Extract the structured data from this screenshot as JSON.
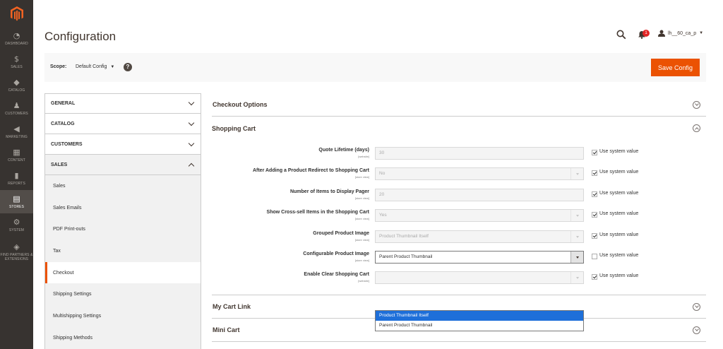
{
  "sidebar": {
    "logo": "magento-logo",
    "items": [
      {
        "label": "DASHBOARD",
        "icon": "◔",
        "name": "dashboard"
      },
      {
        "label": "SALES",
        "icon": "$",
        "name": "sales"
      },
      {
        "label": "CATALOG",
        "icon": "◆",
        "name": "catalog"
      },
      {
        "label": "CUSTOMERS",
        "icon": "♟",
        "name": "customers"
      },
      {
        "label": "MARKETING",
        "icon": "◀",
        "name": "marketing"
      },
      {
        "label": "CONTENT",
        "icon": "▦",
        "name": "content"
      },
      {
        "label": "REPORTS",
        "icon": "▮",
        "name": "reports"
      },
      {
        "label": "STORES",
        "icon": "▤",
        "name": "stores"
      },
      {
        "label": "SYSTEM",
        "icon": "⚙",
        "name": "system"
      },
      {
        "label": "FIND PARTNERS & EXTENSIONS",
        "icon": "◈",
        "name": "find-partners"
      }
    ]
  },
  "header": {
    "title": "Configuration",
    "notifications_count": "1",
    "user_name": "lh__60_ca_p"
  },
  "scope": {
    "label": "Scope:",
    "value": "Default Config",
    "help": "?"
  },
  "actions": {
    "save_label": "Save Config"
  },
  "tabs": [
    {
      "label": "GENERAL",
      "open": false
    },
    {
      "label": "CATALOG",
      "open": false
    },
    {
      "label": "CUSTOMERS",
      "open": false
    },
    {
      "label": "SALES",
      "open": true
    }
  ],
  "sales_items": [
    "Sales",
    "Sales Emails",
    "PDF Print-outs",
    "Tax",
    "Checkout",
    "Shipping Settings",
    "Multishipping Settings",
    "Shipping Methods"
  ],
  "sections": {
    "checkout_options": "Checkout Options",
    "shopping_cart": "Shopping Cart",
    "my_cart_link": "My Cart Link",
    "mini_cart": "Mini Cart"
  },
  "fields": [
    {
      "label": "Quote Lifetime (days)",
      "scope": "[website]",
      "value": "30",
      "type": "text",
      "use_system": true
    },
    {
      "label": "After Adding a Product Redirect to Shopping Cart",
      "scope": "[store view]",
      "value": "No",
      "type": "select",
      "use_system": true
    },
    {
      "label": "Number of Items to Display Pager",
      "scope": "[store view]",
      "value": "20",
      "type": "text",
      "use_system": true
    },
    {
      "label": "Show Cross-sell Items in the Shopping Cart",
      "scope": "[store view]",
      "value": "Yes",
      "type": "select",
      "use_system": true
    },
    {
      "label": "Grouped Product Image",
      "scope": "[store view]",
      "value": "Product Thumbnail Itself",
      "type": "select",
      "use_system": true
    },
    {
      "label": "Configurable Product Image",
      "scope": "[store view]",
      "value": "Parent Product Thumbnail",
      "type": "select",
      "use_system": false,
      "active": true
    },
    {
      "label": "Enable Clear Shopping Cart",
      "scope": "[website]",
      "value": "",
      "type": "select",
      "use_system": true
    }
  ],
  "use_system_label": "Use system value",
  "dropdown_options": [
    "Product Thumbnail Itself",
    "Parent Product Thumbnail"
  ],
  "colors": {
    "accent": "#eb5202",
    "sidebar": "#373330",
    "highlight": "#1e6fd9"
  }
}
